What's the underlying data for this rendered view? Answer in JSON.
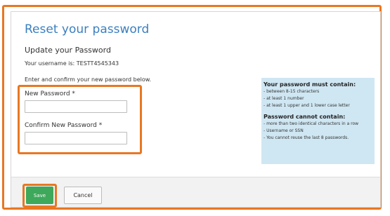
{
  "page": {
    "title": "Reset your password",
    "subtitle": "Update your Password",
    "username_line": "Your username is: TESTT4545343",
    "instructions": "Enter and confirm your new password below."
  },
  "form": {
    "new_password_label": "New Password *",
    "new_password_value": "",
    "confirm_password_label": "Confirm New Password *",
    "confirm_password_value": ""
  },
  "rules": {
    "must_heading": "Your password must contain:",
    "must_items": [
      "- between 8-15 characters",
      "- at least 1 number",
      "- at least 1 upper and 1 lower case letter"
    ],
    "cannot_heading": "Password cannot contain:",
    "cannot_items": [
      "- more than two identical characters in a row",
      "- Username or SSN",
      "- You cannot reuse the last 8 passwords."
    ]
  },
  "footer": {
    "save_label": "Save",
    "cancel_label": "Cancel"
  },
  "colors": {
    "accent_orange": "#e87722",
    "title_blue": "#3a7fbf",
    "save_green": "#3ea85b",
    "rules_bg": "#cfe7f3"
  }
}
